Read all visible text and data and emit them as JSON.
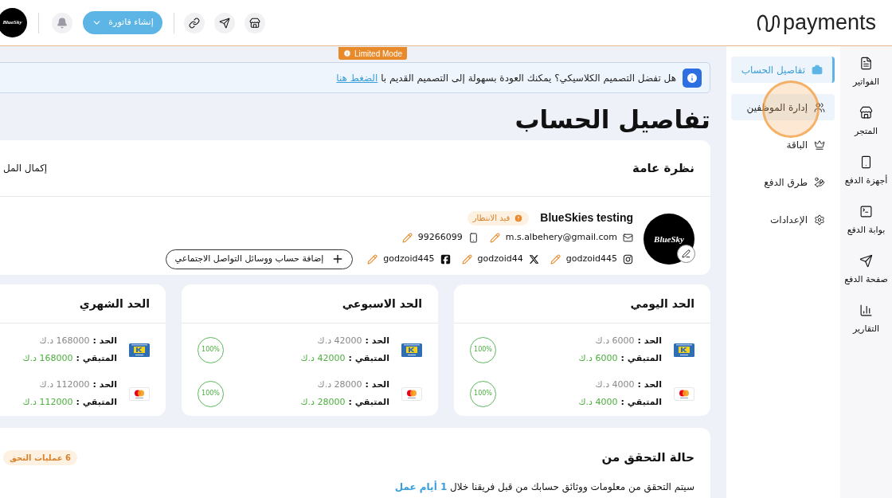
{
  "header": {
    "logo_text": "payments",
    "invoice_button": "إنشاء فاتورة",
    "avatar_text": "BlueSky"
  },
  "limited_mode": "Limited Mode",
  "banner": {
    "text": "هل تفضل التصميم الكلاسيكي؟ يمكنك العودة بسهولة إلى التصميم القديم با",
    "link": "الضغط هنا"
  },
  "rail": [
    {
      "kind": "invoices",
      "label": "الفواتير"
    },
    {
      "kind": "store",
      "label": "المتجر"
    },
    {
      "kind": "devices",
      "label": "أجهزة الدفع"
    },
    {
      "kind": "gateway",
      "label": "بوابة الدفع"
    },
    {
      "kind": "paypage",
      "label": "صفحة الدفع"
    },
    {
      "kind": "reports",
      "label": "التقارير"
    }
  ],
  "sidebar": [
    {
      "kind": "account",
      "label": "تفاصيل الحساب",
      "selected": true,
      "highlighted": false
    },
    {
      "kind": "staff",
      "label": "إدارة الموظفين",
      "selected": false,
      "highlighted": true
    },
    {
      "kind": "plan",
      "label": "الباقة",
      "selected": false,
      "highlighted": false
    },
    {
      "kind": "methods",
      "label": "طرق الدفع",
      "selected": false,
      "highlighted": false
    },
    {
      "kind": "settings",
      "label": "الإعدادات",
      "selected": false,
      "highlighted": false
    }
  ],
  "page_title": "تفاصيل الحساب",
  "overview": {
    "title": "نظرة عامة",
    "complete_link": "إكمال المل",
    "avatar_text": "BlueSky",
    "name": "BlueSkies testing",
    "status": "قيد الانتظار",
    "contacts": [
      {
        "kind": "email",
        "value": "m.s.albehery@gmail.com"
      },
      {
        "kind": "phone",
        "value": "99266099"
      }
    ],
    "socials": [
      {
        "kind": "instagram",
        "value": "godzoid445"
      },
      {
        "kind": "x",
        "value": "godzoid44"
      },
      {
        "kind": "facebook",
        "value": "godzoid445"
      }
    ],
    "add_social": "إضافة حساب ووسائل التواصل الاجتماعي"
  },
  "limits": [
    {
      "title": "الحد اليومي",
      "rows": [
        {
          "kind": "knet",
          "limit_label": "الحد :",
          "limit": "6000 د.ك",
          "remaining_label": "المتبقي :",
          "remaining": "6000 د.ك",
          "percent": "100%"
        },
        {
          "kind": "mastercard",
          "limit_label": "الحد :",
          "limit": "4000 د.ك",
          "remaining_label": "المتبقي :",
          "remaining": "4000 د.ك",
          "percent": "100%"
        }
      ]
    },
    {
      "title": "الحد الاسبوعي",
      "rows": [
        {
          "kind": "knet",
          "limit_label": "الحد :",
          "limit": "42000 د.ك",
          "remaining_label": "المتبقي :",
          "remaining": "42000 د.ك",
          "percent": "100%"
        },
        {
          "kind": "mastercard",
          "limit_label": "الحد :",
          "limit": "28000 د.ك",
          "remaining_label": "المتبقي :",
          "remaining": "28000 د.ك",
          "percent": "100%"
        }
      ]
    },
    {
      "title": "الحد الشهري",
      "rows": [
        {
          "kind": "knet",
          "limit_label": "الحد :",
          "limit": "168000 د.ك",
          "remaining_label": "المتبقي :",
          "remaining": "168000 د.ك"
        },
        {
          "kind": "mastercard",
          "limit_label": "الحد :",
          "limit": "112000 د.ك",
          "remaining_label": "المتبقي :",
          "remaining": "112000 د.ك"
        }
      ]
    }
  ],
  "verification": {
    "title": "حالة التحقق من",
    "text": "سيتم التحقق من معلومات ووثائق حسابك من قبل فريقنا خلال **1 أيام عمل**",
    "badge": "6 عمليات التحق"
  }
}
